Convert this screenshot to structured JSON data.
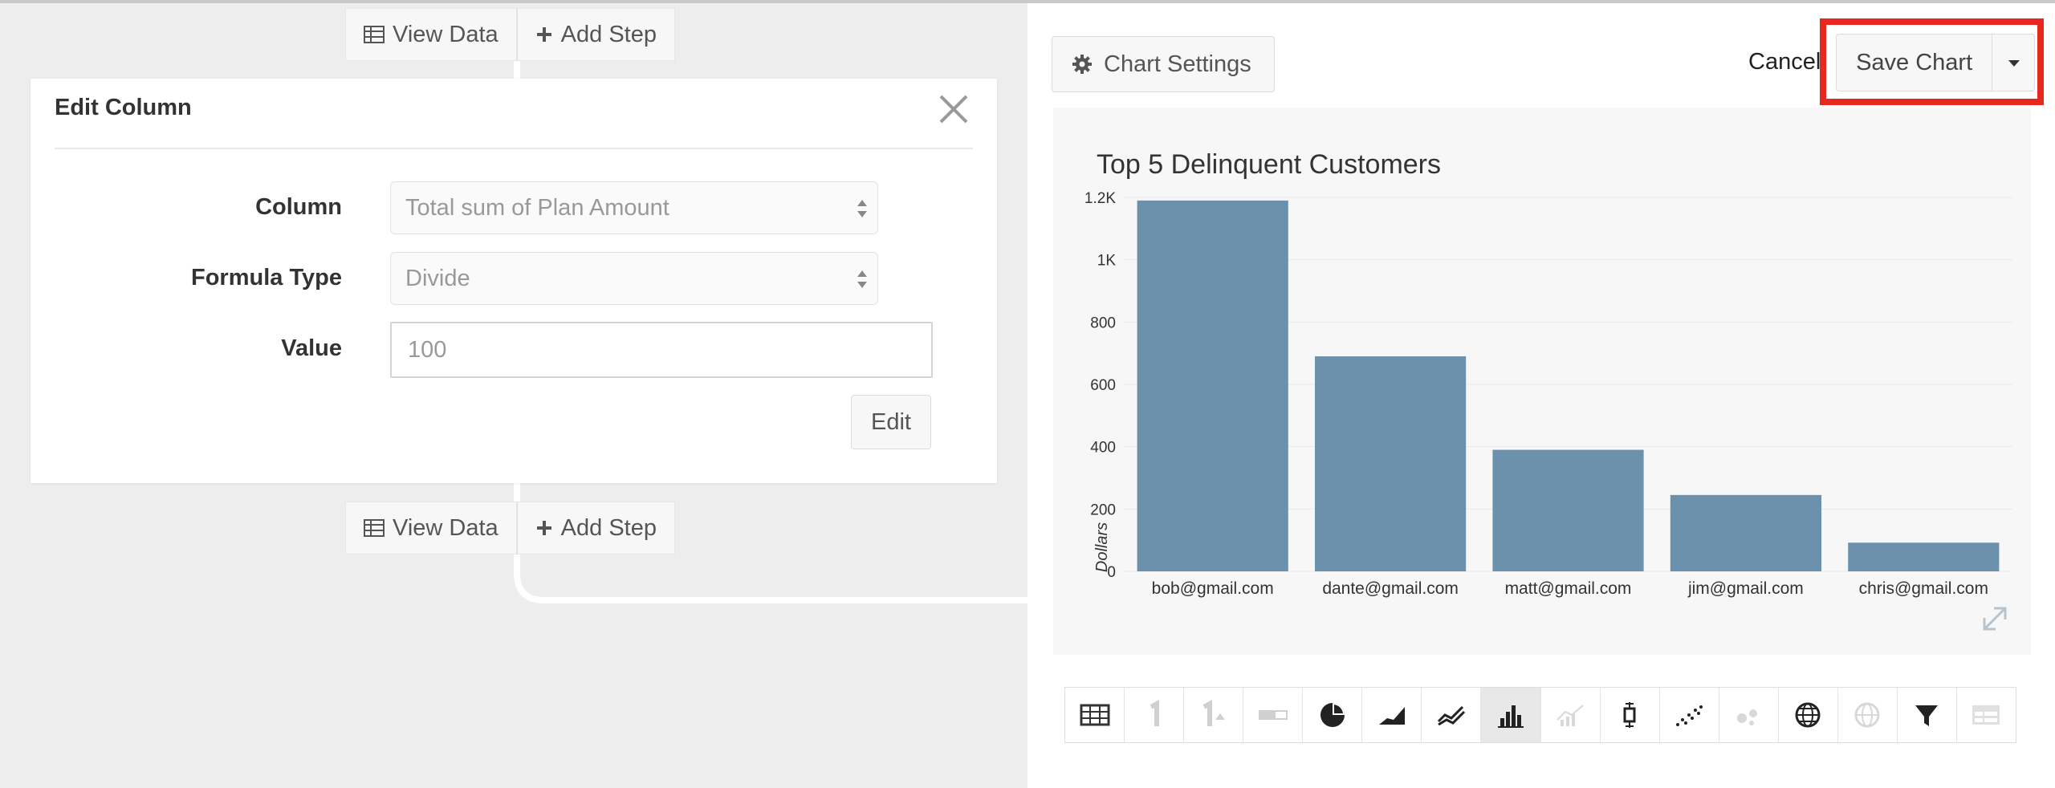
{
  "pipeline": {
    "top_actions": {
      "view_data": "View Data",
      "add_step": "Add Step"
    },
    "bottom_actions": {
      "view_data": "View Data",
      "add_step": "Add Step"
    }
  },
  "edit_column": {
    "title": "Edit Column",
    "column_label": "Column",
    "column_value": "Total sum of Plan Amount",
    "formula_label": "Formula Type",
    "formula_value": "Divide",
    "value_label": "Value",
    "value_placeholder": "100",
    "edit_button": "Edit"
  },
  "header": {
    "chart_settings": "Chart Settings",
    "cancel": "Cancel",
    "save_chart": "Save Chart"
  },
  "chart_data": {
    "type": "bar",
    "title": "Top 5 Delinquent Customers",
    "xlabel": "",
    "ylabel": "Dollars",
    "categories": [
      "bob@gmail.com",
      "dante@gmail.com",
      "matt@gmail.com",
      "jim@gmail.com",
      "chris@gmail.com"
    ],
    "values": [
      1190,
      690,
      390,
      245,
      92
    ],
    "ylim": [
      0,
      1200
    ],
    "yticks": [
      0,
      200,
      400,
      600,
      800,
      1000,
      1200
    ],
    "ytick_labels": [
      "0",
      "200",
      "400",
      "600",
      "800",
      "1K",
      "1.2K"
    ],
    "bar_color": "#6b91ad",
    "grid": true
  },
  "colors": {
    "highlight": "#e8281e",
    "bar": "#6b91ad"
  },
  "toolbar_icons": [
    "table-icon",
    "single-number-icon",
    "number-trend-icon",
    "progress-bar-icon",
    "pie-chart-icon",
    "area-chart-icon",
    "line-chart-icon",
    "bar-chart-icon",
    "combo-chart-icon",
    "box-plot-icon",
    "scatter-plot-icon",
    "bubble-chart-icon",
    "globe-icon",
    "region-map-icon",
    "funnel-icon",
    "pivot-table-icon"
  ]
}
